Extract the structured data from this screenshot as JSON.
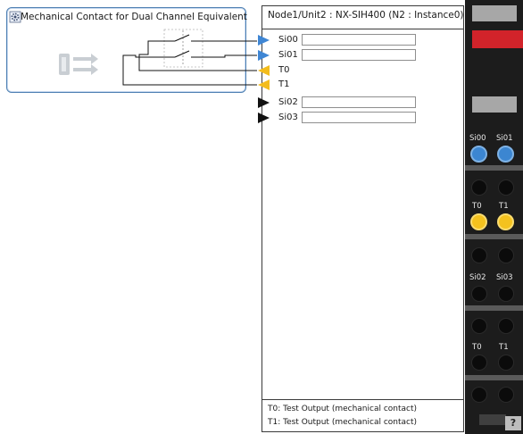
{
  "function_block": {
    "title": "Mechanical Contact for Dual Channel Equivalent",
    "gear_icon": "gear-icon",
    "block_icon": "dual-contact-icon"
  },
  "unit": {
    "title": "Node1/Unit2 : NX-SIH400 (N2 : Instance0)",
    "pins": [
      {
        "label": "Si00",
        "type": "input",
        "value": ""
      },
      {
        "label": "Si01",
        "type": "input",
        "value": ""
      },
      {
        "label": "T0",
        "type": "test-output"
      },
      {
        "label": "T1",
        "type": "test-output"
      },
      {
        "label": "Si02",
        "type": "input",
        "value": ""
      },
      {
        "label": "Si03",
        "type": "input",
        "value": ""
      }
    ],
    "footer": [
      "T0: Test Output (mechanical contact)",
      "T1: Test Output (mechanical contact)"
    ]
  },
  "hardware": {
    "terminal_labels": [
      [
        "Si00",
        "Si01"
      ],
      [
        "T0",
        "T1"
      ],
      [
        "Si02",
        "Si03"
      ],
      [
        "T0",
        "T1"
      ]
    ],
    "help_label": "?"
  },
  "colors": {
    "input_arrow": "#3f86d4",
    "test_output_arrow": "#f3bc1c",
    "unused_arrow": "#111111",
    "block_border": "#4d7fb2",
    "red_indicator": "#d2232a"
  }
}
